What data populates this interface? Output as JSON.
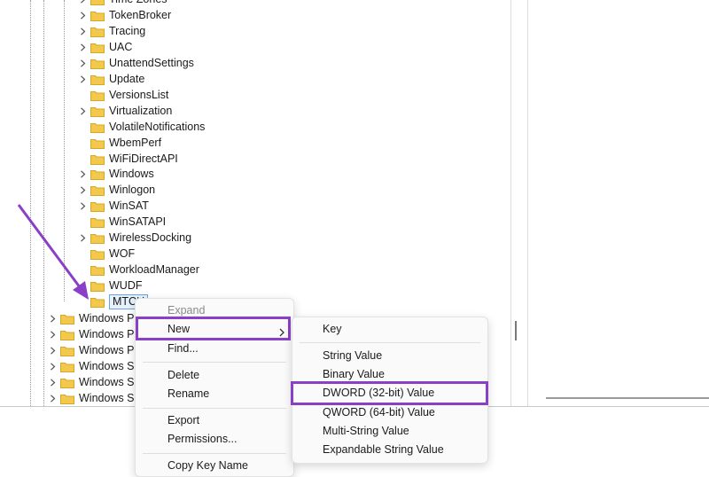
{
  "tree": {
    "keys": [
      {
        "label": "Time Zones",
        "expandable": true
      },
      {
        "label": "TokenBroker",
        "expandable": true
      },
      {
        "label": "Tracing",
        "expandable": true
      },
      {
        "label": "UAC",
        "expandable": true
      },
      {
        "label": "UnattendSettings",
        "expandable": true
      },
      {
        "label": "Update",
        "expandable": true
      },
      {
        "label": "VersionsList",
        "expandable": false
      },
      {
        "label": "Virtualization",
        "expandable": true
      },
      {
        "label": "VolatileNotifications",
        "expandable": false
      },
      {
        "label": "WbemPerf",
        "expandable": false
      },
      {
        "label": "WiFiDirectAPI",
        "expandable": false
      },
      {
        "label": "Windows",
        "expandable": true
      },
      {
        "label": "Winlogon",
        "expandable": true
      },
      {
        "label": "WinSAT",
        "expandable": true
      },
      {
        "label": "WinSATAPI",
        "expandable": false
      },
      {
        "label": "WirelessDocking",
        "expandable": true
      },
      {
        "label": "WOF",
        "expandable": false
      },
      {
        "label": "WorkloadManager",
        "expandable": false
      },
      {
        "label": "WUDF",
        "expandable": false
      },
      {
        "label": "MTCU",
        "expandable": false,
        "selected": true
      }
    ],
    "parent_keys": [
      {
        "label": "Windows Pe"
      },
      {
        "label": "Windows Ph"
      },
      {
        "label": "Windows Po"
      },
      {
        "label": "Windows Sc"
      },
      {
        "label": "Windows Se"
      },
      {
        "label": "Windows Se"
      }
    ]
  },
  "context_menu": {
    "items": [
      {
        "label": "Expand",
        "disabled": true
      },
      {
        "label": "New",
        "has_submenu": true,
        "highlighted": true
      },
      {
        "label": "Find..."
      },
      {
        "label": "Delete"
      },
      {
        "label": "Rename"
      },
      {
        "label": "Export"
      },
      {
        "label": "Permissions..."
      },
      {
        "label": "Copy Key Name"
      }
    ]
  },
  "new_submenu": {
    "items": [
      {
        "label": "Key"
      },
      {
        "label": "String Value"
      },
      {
        "label": "Binary Value"
      },
      {
        "label": "DWORD (32-bit) Value",
        "highlighted": true
      },
      {
        "label": "QWORD (64-bit) Value"
      },
      {
        "label": "Multi-String Value"
      },
      {
        "label": "Expandable String Value"
      }
    ]
  },
  "colors": {
    "highlight": "#8a3fc7",
    "arrow": "#8a3fc7",
    "folder": "#f2c94c",
    "selection_border": "#6aa4e6"
  },
  "icons": {
    "expand": "chevron-right-icon",
    "folder": "folder-icon",
    "submenu": "chevron-right-icon"
  }
}
